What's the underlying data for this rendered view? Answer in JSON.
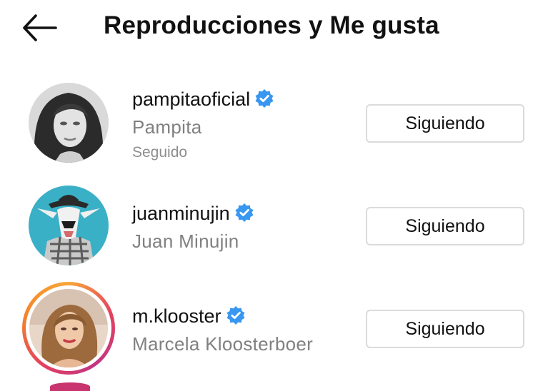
{
  "header": {
    "title": "Reproducciones y Me gusta",
    "back_icon": "arrow-left-icon"
  },
  "colors": {
    "verified_badge": "#3897f0",
    "secondary_text": "#808080",
    "button_border": "#dbdbdb"
  },
  "users": [
    {
      "username": "pampitaoficial",
      "full_name": "Pampita",
      "status": "Seguido",
      "verified": true,
      "button_label": "Siguiendo",
      "has_story": false
    },
    {
      "username": "juanminujin",
      "full_name": "Juan Minujin",
      "status": "",
      "verified": true,
      "button_label": "Siguiendo",
      "has_story": false
    },
    {
      "username": "m.klooster",
      "full_name": "Marcela Kloosterboer",
      "status": "",
      "verified": true,
      "button_label": "Siguiendo",
      "has_story": true
    }
  ]
}
